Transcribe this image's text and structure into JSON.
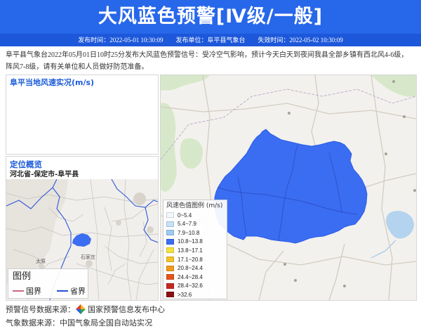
{
  "header": {
    "title": "大风蓝色预警[Ⅳ级/一般]",
    "publish_time_label": "发布时间：",
    "publish_time": "2022-05-01 10:30:09",
    "publisher_label": "发布单位：",
    "publisher": "阜平县气象台",
    "expire_time_label": "失效时间：",
    "expire_time": "2022-05-02 10:30:09",
    "title_band_color": "#2767ea",
    "info_bar_color": "#1d58da"
  },
  "description": "阜平县气象台2022年05月01日10时25分发布大风蓝色预警信号：受冷空气影响，预计今天白天到夜间我县全部乡镇有西北风4-6级，阵风7-8级，请有关单位和人员做好防范准备。",
  "wind_panel": {
    "title": "阜平当地风速实况(m/s)"
  },
  "location_panel": {
    "title": "定位概览",
    "region_path": "河北省-保定市-阜平县",
    "map_labels": [
      "太原",
      "石家庄"
    ],
    "marker_color": "#3b6df2",
    "legend": {
      "title": "图例",
      "items": [
        {
          "label": "国界",
          "color": "#c9677f"
        },
        {
          "label": "省界",
          "color": "#2251d6"
        }
      ]
    }
  },
  "warning_map": {
    "region_color": "#3b6df2",
    "legend": {
      "title": "风速色值图例 (m/s)",
      "items": [
        {
          "range": "0~5.4",
          "color": "#f3f8fd"
        },
        {
          "range": "5.4~7.9",
          "color": "#c6e1f8"
        },
        {
          "range": "7.9~10.8",
          "color": "#9ccbf3"
        },
        {
          "range": "10.8~13.8",
          "color": "#3b6df2"
        },
        {
          "range": "13.8~17.1",
          "color": "#f5e23a"
        },
        {
          "range": "17.1~20.8",
          "color": "#f4c42b"
        },
        {
          "range": "20.8~24.4",
          "color": "#f29a1d"
        },
        {
          "range": "24.4~28.4",
          "color": "#e8531b"
        },
        {
          "range": "28.4~32.6",
          "color": "#c7261d"
        },
        {
          "range": ">32.6",
          "color": "#8b1010"
        }
      ]
    }
  },
  "footer": {
    "signal_source_label": "预警信号数据来源：",
    "signal_source": "国家预警信息发布中心",
    "weather_source_label": "气象数据来源：",
    "weather_source": "中国气象局全国自动站实况"
  }
}
